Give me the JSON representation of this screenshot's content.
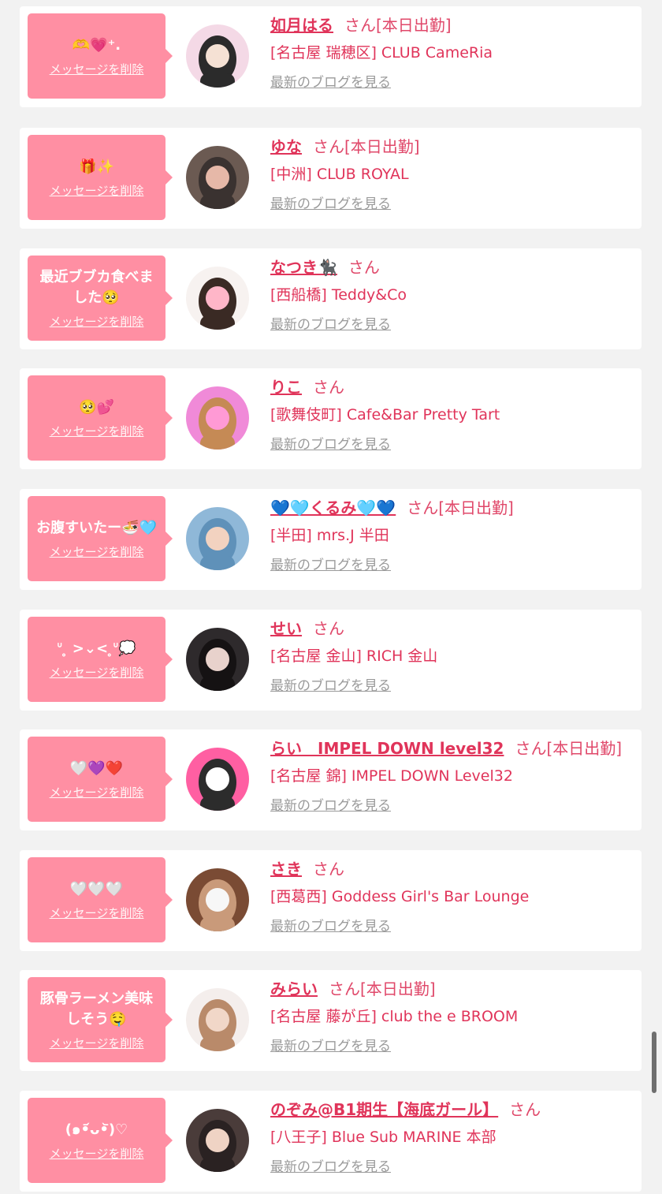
{
  "colors": {
    "page_background": "#f2f2f2",
    "card_background": "#ffffff",
    "bubble_pink": "#ff8fa3",
    "name_pink": "#e0345a",
    "link_gray": "#9a9a9a"
  },
  "labels": {
    "delete_message": "メッセージを削除",
    "latest_blog": "最新のブログを見る",
    "honorific": "さん"
  },
  "items": [
    {
      "message": "🫶💗⁺.",
      "name": "如月はる",
      "status": "[本日出勤]",
      "shop": "[名古屋 瑞穂区] CLUB CameRia",
      "avatar_colors": [
        "#f4d9e6",
        "#2b2b2b",
        "#f5e1d4"
      ]
    },
    {
      "message": "🎁✨",
      "name": "ゆな",
      "status": "[本日出勤]",
      "shop": "[中洲] CLUB ROYAL",
      "avatar_colors": [
        "#6b5a52",
        "#3a3230",
        "#e6b8a8"
      ]
    },
    {
      "message": "最近ブブカ食べました🥺",
      "name": "なつき🐈‍⬛",
      "status": "",
      "shop": "[西船橋] Teddy&Co",
      "avatar_colors": [
        "#f7f2f0",
        "#3a2a24",
        "#ffb6c8"
      ]
    },
    {
      "message": "🥺💕",
      "name": "りこ",
      "status": "",
      "shop": "[歌舞伎町] Cafe&Bar Pretty Tart",
      "avatar_colors": [
        "#f08ad8",
        "#c58a55",
        "#ff9ad5"
      ]
    },
    {
      "message": "お腹すいたー🍜🩵",
      "name": "💙🩵くるみ🩵💙",
      "status": "[本日出勤]",
      "shop": "[半田] mrs.J 半田",
      "avatar_colors": [
        "#8fb8d8",
        "#5f91b9",
        "#f2d2c0"
      ]
    },
    {
      "message": "ᐡ ̥ >⌄<  ̥ᐡ💭",
      "name": "せい",
      "status": "",
      "shop": "[名古屋 金山] RICH 金山",
      "avatar_colors": [
        "#2e2a2c",
        "#151213",
        "#e8d2cc"
      ]
    },
    {
      "message": "🤍💜❤️",
      "name": "らい　IMPEL DOWN level32",
      "status": "[本日出勤]",
      "shop": "[名古屋 錦] IMPEL DOWN Level32",
      "avatar_colors": [
        "#ff5fa2",
        "#2c2c2c",
        "#ffffff"
      ]
    },
    {
      "message": "🤍🤍🤍",
      "name": "さき",
      "status": "",
      "shop": "[西葛西] Goddess Girl's Bar Lounge",
      "avatar_colors": [
        "#7a4b34",
        "#c99a7a",
        "#f7f7f7"
      ]
    },
    {
      "message": "豚骨ラーメン美味しそう🤤",
      "name": "みらい",
      "status": "[本日出勤]",
      "shop": "[名古屋 藤が丘] club the e BROOM",
      "avatar_colors": [
        "#f4eeec",
        "#b98a6a",
        "#f1d7c8"
      ]
    },
    {
      "message": "(๑•᷄ᴗ•᷅)♡",
      "name": "のぞみ@B1期生【海底ガール】",
      "status": "",
      "shop": "[八王子] Blue Sub MARINE 本部",
      "avatar_colors": [
        "#4a3c3a",
        "#2a2222",
        "#efd3c4"
      ]
    }
  ]
}
